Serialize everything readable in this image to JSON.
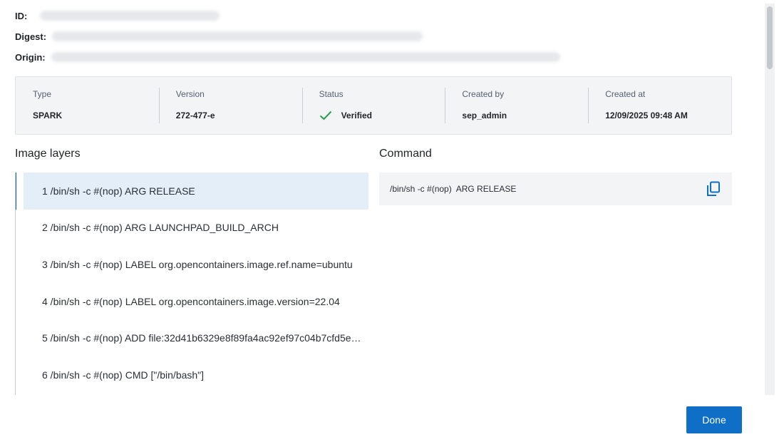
{
  "meta": {
    "id_label": "ID:",
    "digest_label": "Digest:",
    "origin_label": "Origin:"
  },
  "summary": {
    "type_label": "Type",
    "type_value": "SPARK",
    "version_label": "Version",
    "version_value": "272-477-e",
    "status_label": "Status",
    "status_value": "Verified",
    "created_by_label": "Created by",
    "created_by_value": "sep_admin",
    "created_at_label": "Created at",
    "created_at_value": "12/09/2025 09:48 AM",
    "status_color": "#2e9b4e"
  },
  "layers": {
    "title": "Image layers",
    "selected_index": 0,
    "items": [
      "1 /bin/sh -c #(nop) ARG RELEASE",
      "2 /bin/sh -c #(nop) ARG LAUNCHPAD_BUILD_ARCH",
      "3 /bin/sh -c #(nop) LABEL org.opencontainers.image.ref.name=ubuntu",
      "4 /bin/sh -c #(nop) LABEL org.opencontainers.image.version=22.04",
      "5 /bin/sh -c #(nop) ADD file:32d41b6329e8f89fa4ac92ef97c04b7cfd5e…",
      "6 /bin/sh -c #(nop) CMD [\"/bin/bash\"]"
    ]
  },
  "command": {
    "title": "Command",
    "text": "/bin/sh -c #(nop)  ARG RELEASE",
    "copy_icon": "copy-icon"
  },
  "footer": {
    "done_label": "Done",
    "accent_color": "#0f6fc6"
  }
}
